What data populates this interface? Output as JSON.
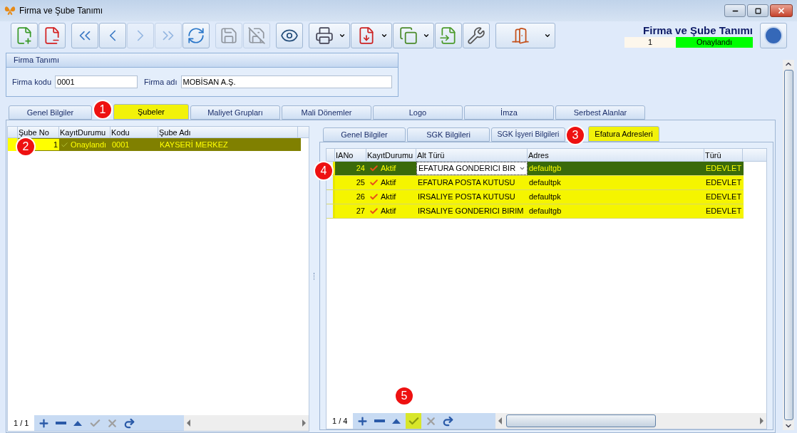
{
  "window": {
    "title": "Firma ve Şube Tanımı"
  },
  "toolbar": [
    {
      "kind": "new",
      "disabled": false,
      "dropdown": false
    },
    {
      "kind": "delete",
      "disabled": false,
      "dropdown": false
    },
    {
      "kind": "first",
      "disabled": false,
      "dropdown": false
    },
    {
      "kind": "prev",
      "disabled": false,
      "dropdown": false
    },
    {
      "kind": "next",
      "disabled": true,
      "dropdown": false
    },
    {
      "kind": "last",
      "disabled": true,
      "dropdown": false
    },
    {
      "kind": "refresh",
      "disabled": false,
      "dropdown": false
    },
    {
      "kind": "save",
      "disabled": true,
      "dropdown": false
    },
    {
      "kind": "cancel",
      "disabled": true,
      "dropdown": false
    },
    {
      "kind": "preview",
      "disabled": false,
      "dropdown": false
    },
    {
      "kind": "print",
      "disabled": false,
      "dropdown": true
    },
    {
      "kind": "pdf",
      "disabled": false,
      "dropdown": true
    },
    {
      "kind": "copy",
      "disabled": false,
      "dropdown": true
    },
    {
      "kind": "import",
      "disabled": false,
      "dropdown": false
    },
    {
      "kind": "tools",
      "disabled": false,
      "dropdown": false
    },
    {
      "kind": "exit",
      "disabled": false,
      "dropdown": true
    }
  ],
  "header": {
    "title": "Firma ve Şube Tanımı",
    "record_no": "1",
    "status": "Onaylandı"
  },
  "firma_panel": {
    "title": "Firma Tanımı",
    "fields": [
      {
        "label": "Firma kodu",
        "value": "0001"
      },
      {
        "label": "Firma adı",
        "value": "MOBİSAN A.Ş."
      }
    ]
  },
  "tabs": [
    {
      "label": "Genel Bilgiler",
      "selected": false
    },
    {
      "label": "Şubeler",
      "selected": true
    },
    {
      "label": "Maliyet Grupları",
      "selected": false
    },
    {
      "label": "Mali Dönemler",
      "selected": false
    },
    {
      "label": "Logo",
      "selected": false
    },
    {
      "label": "İmza",
      "selected": false
    },
    {
      "label": "Serbest Alanlar",
      "selected": false
    }
  ],
  "branch_grid": {
    "columns": [
      "Şube No",
      "KayıtDurumu",
      "Kodu",
      "Şube Adı"
    ],
    "rows": [
      {
        "no": "1",
        "status": "Onaylandı",
        "code": "0001",
        "name": "KAYSERİ MERKEZ",
        "selected": true
      }
    ],
    "counter": "1 / 1",
    "nav": [
      {
        "kind": "add",
        "disabled": false,
        "highlighted": false
      },
      {
        "kind": "remove",
        "disabled": false,
        "highlighted": false
      },
      {
        "kind": "up",
        "disabled": false,
        "highlighted": false
      },
      {
        "kind": "confirm",
        "disabled": true,
        "highlighted": false
      },
      {
        "kind": "discard",
        "disabled": true,
        "highlighted": false
      },
      {
        "kind": "undo",
        "disabled": false,
        "highlighted": false
      }
    ]
  },
  "subtabs": [
    {
      "label": "Genel Bilgiler",
      "selected": false
    },
    {
      "label": "SGK Bilgileri",
      "selected": false
    },
    {
      "label": "SGK İşyeri Bilgileri",
      "selected": false
    },
    {
      "label": "Efatura Adresleri",
      "selected": true
    }
  ],
  "address_grid": {
    "columns": [
      "IANo",
      "KayıtDurumu",
      "Alt Türü",
      "Adres",
      "Türü"
    ],
    "rows": [
      {
        "no": "24",
        "status": "Aktif",
        "subtype": "EFATURA GONDERICI BIR",
        "address": "defaultgb",
        "type": "EDEVLET",
        "selected": true
      },
      {
        "no": "25",
        "status": "Aktif",
        "subtype": "EFATURA POSTA KUTUSU",
        "address": "defaultpk",
        "type": "EDEVLET",
        "selected": false
      },
      {
        "no": "26",
        "status": "Aktif",
        "subtype": "IRSALIYE POSTA KUTUSU",
        "address": "defaultpk",
        "type": "EDEVLET",
        "selected": false
      },
      {
        "no": "27",
        "status": "Aktif",
        "subtype": "IRSALIYE GONDERICI BIRIM",
        "address": "defaultgb",
        "type": "EDEVLET",
        "selected": false
      }
    ],
    "counter": "1 / 4",
    "nav": [
      {
        "kind": "add",
        "disabled": false,
        "highlighted": false
      },
      {
        "kind": "remove",
        "disabled": false,
        "highlighted": false
      },
      {
        "kind": "up",
        "disabled": false,
        "highlighted": false
      },
      {
        "kind": "confirm",
        "disabled": false,
        "highlighted": true
      },
      {
        "kind": "discard",
        "disabled": true,
        "highlighted": false
      },
      {
        "kind": "undo",
        "disabled": false,
        "highlighted": false
      }
    ]
  },
  "callouts": [
    "1",
    "2",
    "3",
    "4",
    "5"
  ]
}
